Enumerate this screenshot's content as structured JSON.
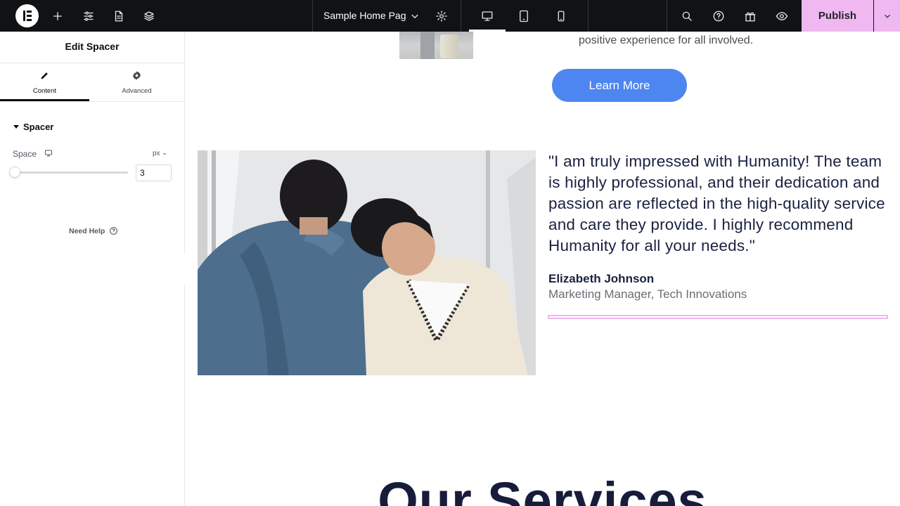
{
  "topbar": {
    "page_title": "Sample Home Page",
    "publish_label": "Publish",
    "icons": [
      "elementor-logo-icon",
      "add-icon",
      "settings-sliders-icon",
      "page-icon",
      "layers-icon",
      "chevron-down-icon",
      "gear-icon",
      "desktop-icon",
      "tablet-icon",
      "mobile-icon",
      "search-icon",
      "help-icon",
      "gift-icon",
      "eye-icon"
    ]
  },
  "panel": {
    "title": "Edit Spacer",
    "tabs": [
      {
        "label": "Content",
        "active": true
      },
      {
        "label": "Advanced",
        "active": false
      }
    ],
    "section_title": "Spacer",
    "control": {
      "label": "Space",
      "unit": "px",
      "value": "3",
      "slider_fraction": 0.01
    },
    "need_help": "Need Help"
  },
  "canvas": {
    "top_text": "positive experience for all involved.",
    "learn_more": "Learn More",
    "quote": "\"I am truly impressed with Humanity! The team is highly professional, and their dedication and passion are reflected in the high-quality service and care they provide. I highly recommend Humanity for all your needs.\"",
    "author_name": "Elizabeth Johnson",
    "author_role": "Marketing Manager, Tech Innovations",
    "services_heading": "Our Services"
  },
  "colors": {
    "topbar_bg": "#111214",
    "publish_bg": "#f0b8f0",
    "button_blue": "#4d86f0",
    "heading_navy": "#1b2140"
  }
}
